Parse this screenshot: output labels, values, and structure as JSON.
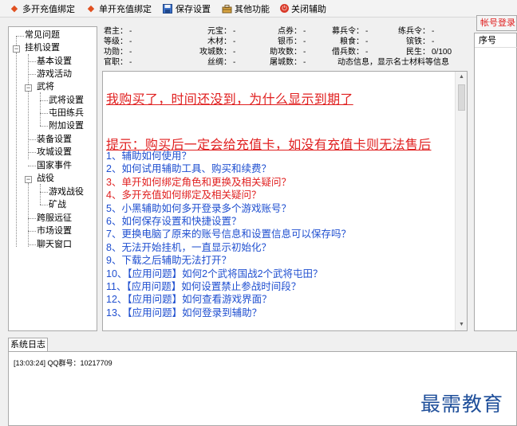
{
  "toolbar": {
    "multi_bind": "多开充值绑定",
    "single_bind": "单开充值绑定",
    "save_settings": "保存设置",
    "other_functions": "其他功能",
    "close_helper": "关闭辅助"
  },
  "tree": {
    "common_problems": "常见问题",
    "hang_settings": "挂机设置",
    "basic_settings": "基本设置",
    "game_activities": "游戏活动",
    "general": "武将",
    "general_settings": "武将设置",
    "farm_train": "屯田练兵",
    "extra_settings": "附加设置",
    "equipment_settings": "装备设置",
    "siege_settings": "攻城设置",
    "state_events": "国家事件",
    "battle": "战役",
    "game_battle": "游戏战役",
    "mine_battle": "矿战",
    "cross_server": "跨服远征",
    "market_settings": "市场设置",
    "chat_window": "聊天窗口"
  },
  "info": {
    "lord": {
      "label": "君主：",
      "value": "-"
    },
    "gold": {
      "label": "元宝：",
      "value": "-"
    },
    "coupons": {
      "label": "点券：",
      "value": "-"
    },
    "recruit_order": {
      "label": "募兵令：",
      "value": "-"
    },
    "train_order": {
      "label": "练兵令：",
      "value": "-"
    },
    "level": {
      "label": "等级：",
      "value": "-"
    },
    "wood": {
      "label": "木材：",
      "value": "-"
    },
    "silver": {
      "label": "银币：",
      "value": "-"
    },
    "food": {
      "label": "粮食：",
      "value": "-"
    },
    "iron": {
      "label": "镔铁：",
      "value": "-"
    },
    "merit": {
      "label": "功勋：",
      "value": "-"
    },
    "siege_count": {
      "label": "攻城数：",
      "value": "-"
    },
    "assist_count": {
      "label": "助攻数：",
      "value": "-"
    },
    "borrow_troops": {
      "label": "借兵数：",
      "value": "-"
    },
    "civilians": {
      "label": "民生：",
      "value": "0/100"
    },
    "official": {
      "label": "官职：",
      "value": "-"
    },
    "silk": {
      "label": "丝绸：",
      "value": "-"
    },
    "massacre_count": {
      "label": "屠城数：",
      "value": "-"
    },
    "dynamic_info": "动态信息，显示名士材料等信息"
  },
  "content": {
    "notice1": "我购买了，时间还没到，为什么显示到期了",
    "notice2": "提示：购买后一定会给充值卡，如没有充值卡则无法售后",
    "faq": [
      {
        "text": "1、辅助如何使用？",
        "color": "#1f4fd0"
      },
      {
        "text": "2、如何试用辅助工具、购买和续费？",
        "color": "#1f4fd0"
      },
      {
        "text": "3、单开如何绑定角色和更换及相关疑问？",
        "color": "#e02020"
      },
      {
        "text": "4、多开充值如何绑定及相关疑问？",
        "color": "#e02020"
      },
      {
        "text": "5、小黑辅助如何多开登录多个游戏账号？",
        "color": "#1f4fd0"
      },
      {
        "text": "6、如何保存设置和快捷设置？",
        "color": "#1f4fd0"
      },
      {
        "text": "7、更换电脑了原来的账号信息和设置信息可以保存吗？",
        "color": "#1f4fd0"
      },
      {
        "text": "8、无法开始挂机，一直显示初始化？",
        "color": "#1f4fd0"
      },
      {
        "text": "9、下载之后辅助无法打开？",
        "color": "#1f4fd0"
      },
      {
        "text": "10、【应用问题】如何2个武将国战2个武将屯田？",
        "color": "#1f4fd0"
      },
      {
        "text": "11、【应用问题】如何设置禁止参战时间段？",
        "color": "#1f4fd0"
      },
      {
        "text": "12、【应用问题】如何查看游戏界面？",
        "color": "#1f4fd0"
      },
      {
        "text": "13、【应用问题】如何登录到辅助？",
        "color": "#1f4fd0"
      }
    ]
  },
  "right_panel": {
    "account_login": "帐号登录",
    "col_no": "序号"
  },
  "log": {
    "tab": "系统日志",
    "line1": "[13:03:24] QQ群号：10217709"
  },
  "watermark": "最需教育",
  "colors": {
    "accent_red": "#e02020",
    "link_blue": "#1f4fd0",
    "watermark_blue": "#1f4f9a"
  }
}
